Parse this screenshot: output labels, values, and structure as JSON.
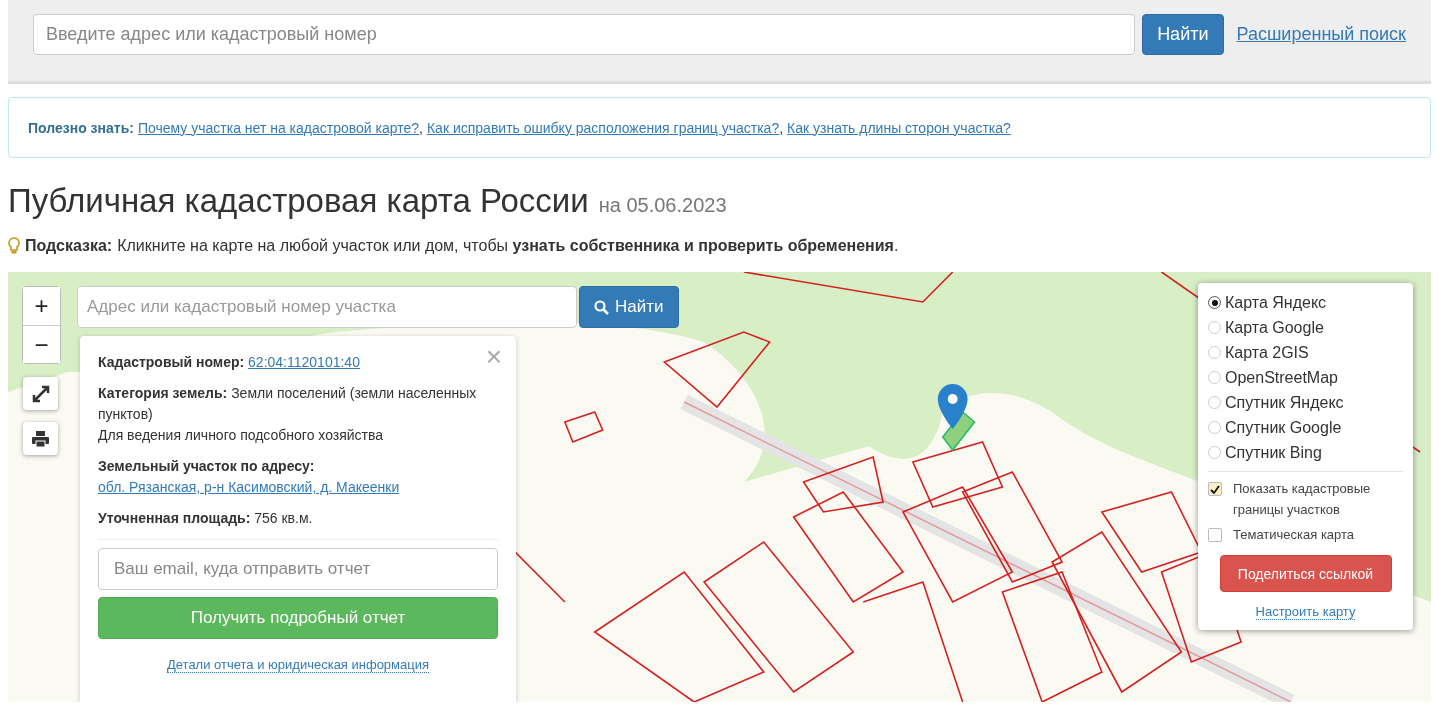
{
  "search_bar": {
    "placeholder": "Введите адрес или кадастровый номер",
    "button": "Найти",
    "advanced_link": "Расширенный поиск"
  },
  "info_box": {
    "label": "Полезно знать:",
    "links": [
      {
        "text": "Почему участка нет на кадастровой карте?",
        "separator": ","
      },
      {
        "text": "Как исправить ошибку расположения границ участка?",
        "separator": ","
      },
      {
        "text": "Как узнать длины сторон участка?"
      }
    ]
  },
  "heading": {
    "title": "Публичная кадастровая карта России",
    "date": "на 05.06.2023"
  },
  "hint": {
    "label": "Подсказка:",
    "text": "Кликните на карте на любой участок или дом, чтобы **узнать собственника и проверить обременения**."
  },
  "map": {
    "zoom_in": "+",
    "zoom_out": "−",
    "search": {
      "placeholder": "Адрес или кадастровый номер участка",
      "button": "Найти"
    },
    "parcel_panel": {
      "close": "×",
      "fields": [
        {
          "label": "Кадастровый номер:",
          "value": "62:04:1120101:40",
          "kind": "link"
        },
        {
          "label": "Категория земель:",
          "value": "Земли поселений (земли населенных пунктов)",
          "kind": "text",
          "note": "Для ведения личного подсобного хозяйства"
        },
        {
          "label": "Земельный участок по адресу:",
          "value": "обл. Рязанская, р-н Касимовский, д. Макеенки",
          "kind": "link"
        },
        {
          "label": "Уточненная площадь:",
          "value": "756 кв.м.",
          "kind": "text"
        }
      ],
      "email_placeholder": "Ваш email, куда отправить отчет",
      "report_button": "Получить подробный отчет",
      "details_link": "Детали отчета и юридическая информация"
    },
    "layers": {
      "base_maps": [
        {
          "label": "Карта Яндекс",
          "selected": true
        },
        {
          "label": "Карта Google",
          "selected": false
        },
        {
          "label": "Карта 2GIS",
          "selected": false
        },
        {
          "label": "OpenStreetMap",
          "selected": false
        },
        {
          "label": "Спутник Яндекс",
          "selected": false
        },
        {
          "label": "Спутник Google",
          "selected": false
        },
        {
          "label": "Спутник Bing",
          "selected": false
        }
      ],
      "overlays": [
        {
          "label": "Показать кадастровые границы участков",
          "checked": true
        },
        {
          "label": "Тематическая карта",
          "checked": false
        }
      ],
      "share_button": "Поделиться ссылкой",
      "settings_link": "Настроить карту"
    }
  }
}
